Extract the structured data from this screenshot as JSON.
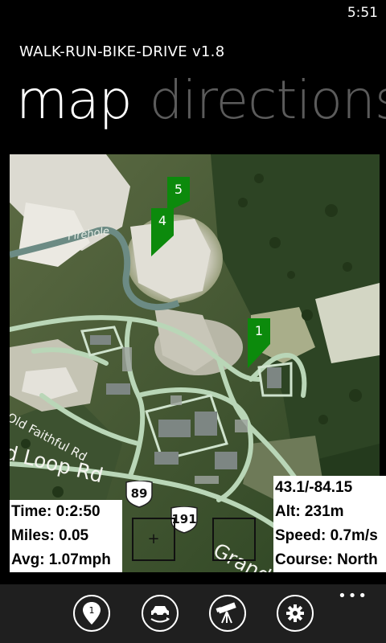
{
  "status": {
    "time": "5:51"
  },
  "app": {
    "title": "WALK-RUN-BIKE-DRIVE v1.8"
  },
  "pivot": {
    "active": "map",
    "inactive": "directions"
  },
  "map": {
    "labels": {
      "firehole": "Firehole",
      "old_faithful_rd": "Old Faithful Rd",
      "loop_rd": "d Loop Rd",
      "grand": "Grand"
    },
    "pins": [
      "5",
      "4",
      "1"
    ],
    "shields": [
      "89",
      "191"
    ],
    "zoom_in_symbol": "+"
  },
  "stats_left": {
    "time": "Time: 0:2:50",
    "miles": "Miles: 0.05",
    "avg": "Avg: 1.07mph"
  },
  "stats_right": {
    "coords": "43.1/-84.15",
    "alt": "Alt: 231m",
    "speed": "Speed: 0.7m/s",
    "course": "Course: North"
  },
  "app_bar": {
    "more": "•••",
    "buttons": [
      "pin-icon",
      "car-route-icon",
      "telescope-icon",
      "gear-icon"
    ],
    "pin_number": "1"
  },
  "colors": {
    "pin_green": "#0c8a0c",
    "road": "#b9d6b7",
    "forest": "#355028",
    "rock": "#d8d6cc"
  }
}
